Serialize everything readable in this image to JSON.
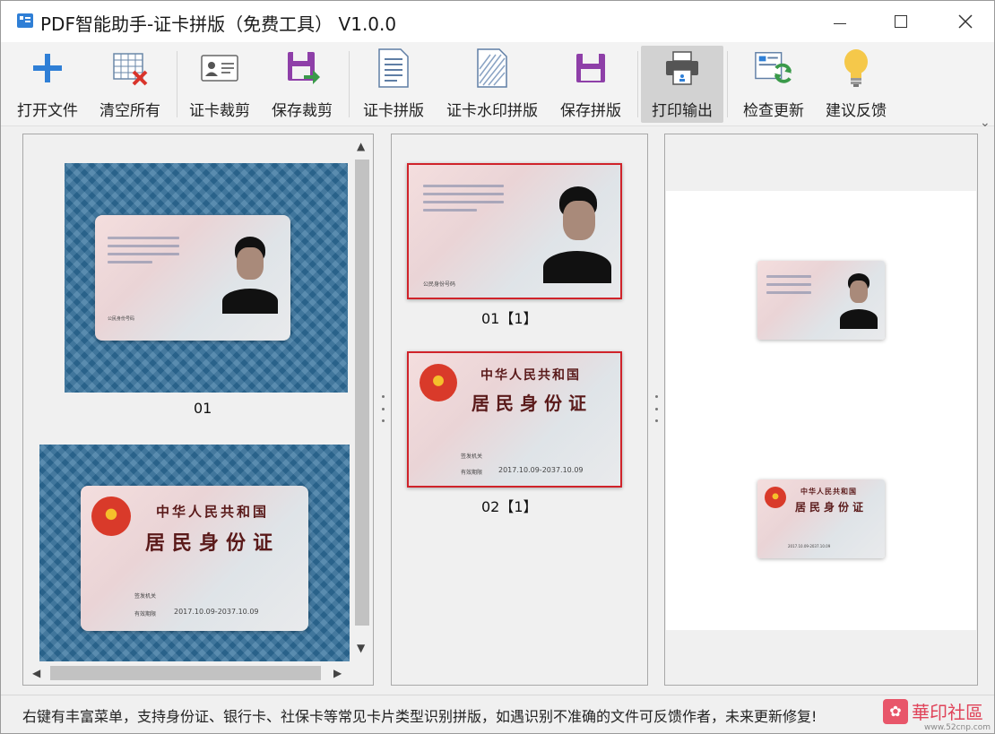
{
  "window": {
    "title": "PDF智能助手-证卡拼版（免费工具） V1.0.0"
  },
  "toolbar": {
    "buttons": [
      {
        "label": "打开文件",
        "icon": "plus-icon"
      },
      {
        "label": "清空所有",
        "icon": "clear-grid-icon"
      },
      {
        "label": "证卡裁剪",
        "icon": "id-card-icon"
      },
      {
        "label": "保存裁剪",
        "icon": "save-export-icon"
      },
      {
        "label": "证卡拼版",
        "icon": "document-icon"
      },
      {
        "label": "证卡水印拼版",
        "icon": "watermark-document-icon"
      },
      {
        "label": "保存拼版",
        "icon": "save-icon"
      },
      {
        "label": "打印输出",
        "icon": "printer-icon"
      },
      {
        "label": "检查更新",
        "icon": "refresh-icon"
      },
      {
        "label": "建议反馈",
        "icon": "lightbulb-icon"
      }
    ],
    "more": "⌄"
  },
  "left_panel": {
    "items": [
      {
        "label": "01"
      }
    ]
  },
  "mid_panel": {
    "items": [
      {
        "label": "01【1】"
      },
      {
        "label": "02【1】"
      }
    ]
  },
  "id_card": {
    "country": "中华人民共和国",
    "card_name": "居民身份证",
    "authority_label": "签发机关",
    "validity_label": "有效期限",
    "validity": "2017.10.09-2037.10.09",
    "number_label": "公民身份号码"
  },
  "status": {
    "text": "右键有丰富菜单，支持身份证、银行卡、社保卡等常见卡片类型识别拼版，如遇识别不准确的文件可反馈作者，未来更新修复!"
  },
  "watermark": {
    "text": "華印社區",
    "url": "www.52cnp.com"
  },
  "colors": {
    "selection": "#d0232a",
    "accent": "#2f7fd6",
    "purple": "#8e3fa8"
  }
}
